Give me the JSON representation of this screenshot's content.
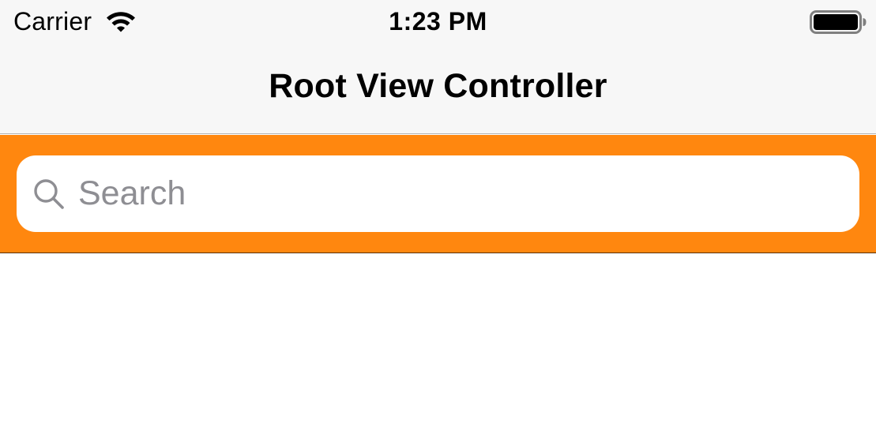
{
  "status_bar": {
    "carrier": "Carrier",
    "time": "1:23 PM",
    "icons": [
      "wifi-icon",
      "battery-icon"
    ]
  },
  "nav_bar": {
    "title": "Root View Controller"
  },
  "search_bar": {
    "placeholder": "Search",
    "value": "",
    "icon": "search-icon",
    "background_color": "#ff870f"
  },
  "colors": {
    "bar_background": "#f7f7f7",
    "placeholder_text": "#8e8e93",
    "accent_orange": "#ff870f"
  }
}
